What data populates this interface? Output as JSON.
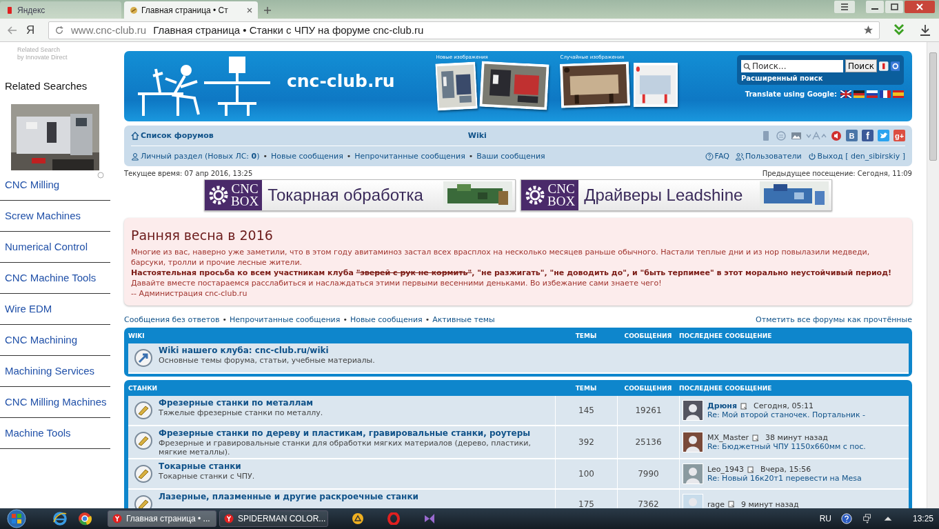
{
  "browser": {
    "tabs": [
      {
        "label": "Яндекс",
        "selected": false
      },
      {
        "label": "Главная страница • Ст",
        "selected": true
      }
    ],
    "home_glyph": "Я",
    "address": {
      "domain": "www.cnc-club.ru",
      "title": "Главная страница • Станки с ЧПУ на форуме cnc-club.ru"
    }
  },
  "sidebar": {
    "attribution": [
      "Related Search",
      "by Innovate Direct"
    ],
    "heading": "Related Searches",
    "links": [
      "CNC Milling",
      "Screw Machines",
      "Numerical Control",
      "CNC Machine Tools",
      "Wire EDM",
      "CNC Machining",
      "Machining Services",
      "CNC Milling Machines",
      "Machine Tools"
    ]
  },
  "header": {
    "site_name": "cnc-club.ru",
    "new_images_label": "Новые изображения",
    "random_images_label": "Случайные изображения",
    "search": {
      "placeholder": "Поиск...",
      "button": "Поиск",
      "advanced": "Расширенный поиск"
    },
    "translate_label": "Translate using Google:"
  },
  "navbar": {
    "forum_list": "Список форумов",
    "wiki": "Wiki",
    "social": [
      {
        "kind": "vk",
        "glyph": "В"
      },
      {
        "kind": "facebook",
        "glyph": "f"
      },
      {
        "kind": "twitter"
      },
      {
        "kind": "gplus",
        "glyph": "g+"
      }
    ],
    "separator": "•",
    "user_links": [
      "Личный раздел (Новых ЛС: **0**)",
      "Новые сообщения",
      "Непрочитанные сообщения",
      "Ваши сообщения"
    ],
    "right_links": [
      {
        "kind": "faq",
        "label": "FAQ"
      },
      {
        "kind": "users",
        "label": "Пользователи"
      },
      {
        "kind": "logout",
        "label": "Выход [ den_sibirskiy ]"
      }
    ]
  },
  "time_bar": {
    "current": "Текущее время: 07 апр 2016, 13:25",
    "last_visit": "Предыдущее посещение: Сегодня, 11:09"
  },
  "banners": [
    {
      "brand_top": "CNC",
      "brand_bottom": "BOX",
      "text": "Токарная обработка"
    },
    {
      "brand_top": "CNC",
      "brand_bottom": "BOX",
      "text": "Драйверы Leadshine"
    }
  ],
  "announcement": {
    "title": "Ранняя весна в 2016",
    "intro": "Многие из вас, наверно уже заметили, что в этом году авитаминоз застал всех врасплох на несколько месяцев раньше обычного. Настали теплые дни и из нор повылазили медведи, барсуки, тролли и прочие лесные жители.",
    "request": [
      {
        "text": "Настоятельная просьба ко всем участникам клуба ",
        "struck": false
      },
      {
        "text": "\"зверей с рук не кормить\"",
        "struck": true
      },
      {
        "text": ", \"не разжигать\", \"не доводить до\", и \"быть терпимее\" в этот морально неустойчивый период!",
        "struck": false
      }
    ],
    "outro": "Давайте вместе постараемся расслабиться и наслаждаться этими первыми весенними деньками. Во избежание сами знаете чего!",
    "signature": "-- Администрация cnc-club.ru"
  },
  "quick_links": {
    "items": [
      "Сообщения без ответов",
      "Непрочитанные сообщения",
      "Новые сообщения",
      "Активные темы"
    ],
    "mark_read": "Отметить все форумы как прочтённые"
  },
  "categories": [
    {
      "name": "WIKI",
      "columns": [
        "ТЕМЫ",
        "СООБЩЕНИЯ",
        "ПОСЛЕДНЕЕ СООБЩЕНИЕ"
      ],
      "forums": [
        {
          "kind": "wiki",
          "title": "Wiki нашего клуба: cnc-club.ru/wiki",
          "description": "Основные темы форума, статьи, учебные материалы."
        }
      ]
    },
    {
      "name": "СТАНКИ",
      "columns": [
        "ТЕМЫ",
        "СООБЩЕНИЯ",
        "ПОСЛЕДНЕЕ СООБЩЕНИЕ"
      ],
      "forums": [
        {
          "kind": "forum",
          "title": "Фрезерные станки по металлам",
          "description": "Тяжелые фрезерные станки по металлу.",
          "topics": "145",
          "posts": "19261",
          "last": {
            "author": "Дрюня",
            "highlighted": true,
            "time": "Сегодня, 05:11",
            "subject": "Re: Мой второй станочек. Портальник -"
          }
        },
        {
          "kind": "forum",
          "title": "Фрезерные станки по дереву и пластикам, гравировальные станки, роутеры",
          "description": "Фрезерные и гравировальные станки для обработки мягких материалов (дерево, пластики, мягкие металлы).",
          "topics": "392",
          "posts": "25136",
          "last": {
            "author": "MX_Master",
            "highlighted": false,
            "time": "38 минут назад",
            "subject": "Re: Бюджетный ЧПУ 1150х660мм с пос."
          }
        },
        {
          "kind": "forum",
          "title": "Токарные станки",
          "description": "Токарные станки с ЧПУ.",
          "topics": "100",
          "posts": "7990",
          "last": {
            "author": "Leo_1943",
            "highlighted": false,
            "time": "Вчера, 15:56",
            "subject": "Re: Новый 16к20т1 перевести на Mesa"
          }
        },
        {
          "kind": "forum",
          "title": "Лазерные, плазменные и другие раскроечные станки",
          "topics": "175",
          "posts": "7362",
          "last": {
            "author": "rage",
            "highlighted": false,
            "time": "9 минут назад"
          }
        }
      ]
    }
  ],
  "taskbar": {
    "windows": [
      {
        "label": "Главная страница • ...",
        "selected": true
      },
      {
        "label": "SPIDERMAN COLOR...",
        "selected": false
      }
    ],
    "language": "RU",
    "clock": "13:25"
  }
}
